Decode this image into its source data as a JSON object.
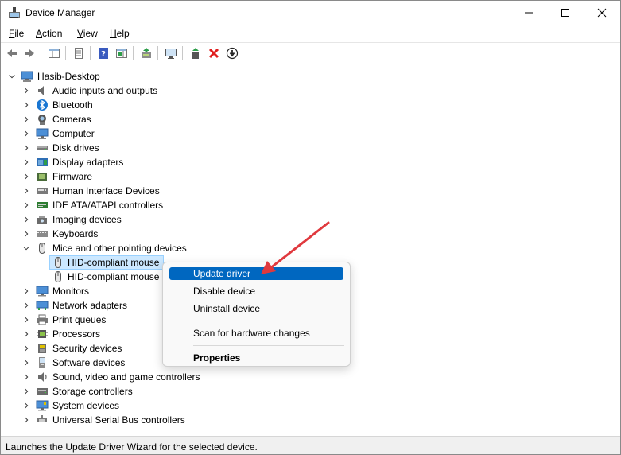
{
  "window": {
    "title": "Device Manager",
    "title_icon": "device-manager-icon"
  },
  "menubar": {
    "items": [
      {
        "label": "File",
        "accel": "F",
        "rest": "ile"
      },
      {
        "label": "Action",
        "accel": "A",
        "rest": "ction"
      },
      {
        "label": "View",
        "accel": "V",
        "rest": "iew"
      },
      {
        "label": "Help",
        "accel": "H",
        "rest": "elp"
      }
    ]
  },
  "toolbar": {
    "buttons": [
      "back-icon",
      "forward-icon",
      "show-hide-console-tree-icon",
      "properties-icon",
      "help-icon",
      "action-pane-icon",
      "update-driver-icon",
      "scan-hardware-icon",
      "enable-device-icon",
      "uninstall-icon",
      "disable-device-icon"
    ]
  },
  "tree": {
    "root": "Hasib-Desktop",
    "categories": [
      {
        "label": "Audio inputs and outputs",
        "icon": "speaker-icon"
      },
      {
        "label": "Bluetooth",
        "icon": "bluetooth-icon"
      },
      {
        "label": "Cameras",
        "icon": "camera-icon"
      },
      {
        "label": "Computer",
        "icon": "computer-icon"
      },
      {
        "label": "Disk drives",
        "icon": "disk-drive-icon"
      },
      {
        "label": "Display adapters",
        "icon": "display-adapter-icon"
      },
      {
        "label": "Firmware",
        "icon": "firmware-icon"
      },
      {
        "label": "Human Interface Devices",
        "icon": "hid-icon"
      },
      {
        "label": "IDE ATA/ATAPI controllers",
        "icon": "ide-controller-icon"
      },
      {
        "label": "Imaging devices",
        "icon": "imaging-device-icon"
      },
      {
        "label": "Keyboards",
        "icon": "keyboard-icon"
      },
      {
        "label": "Mice and other pointing devices",
        "icon": "mouse-icon",
        "expanded": true,
        "children": [
          {
            "label": "HID-compliant mouse",
            "selected": true
          },
          {
            "label": "HID-compliant mouse",
            "selected": false
          }
        ]
      },
      {
        "label": "Monitors",
        "icon": "monitor-icon"
      },
      {
        "label": "Network adapters",
        "icon": "network-adapter-icon"
      },
      {
        "label": "Print queues",
        "icon": "printer-icon"
      },
      {
        "label": "Processors",
        "icon": "processor-icon"
      },
      {
        "label": "Security devices",
        "icon": "security-device-icon"
      },
      {
        "label": "Software devices",
        "icon": "software-device-icon"
      },
      {
        "label": "Sound, video and game controllers",
        "icon": "sound-controller-icon"
      },
      {
        "label": "Storage controllers",
        "icon": "storage-controller-icon"
      },
      {
        "label": "System devices",
        "icon": "system-device-icon"
      },
      {
        "label": "Universal Serial Bus controllers",
        "icon": "usb-controller-icon"
      }
    ]
  },
  "context_menu": {
    "items": [
      {
        "label": "Update driver",
        "active": true
      },
      {
        "label": "Disable device"
      },
      {
        "label": "Uninstall device"
      },
      {
        "label": "Scan for hardware changes"
      },
      {
        "label": "Properties",
        "bold": true
      }
    ]
  },
  "statusbar": {
    "text": "Launches the Update Driver Wizard for the selected device."
  },
  "colors": {
    "accent": "#0067c0",
    "selection": "#cce8ff",
    "annotation_arrow": "#e0393e"
  }
}
